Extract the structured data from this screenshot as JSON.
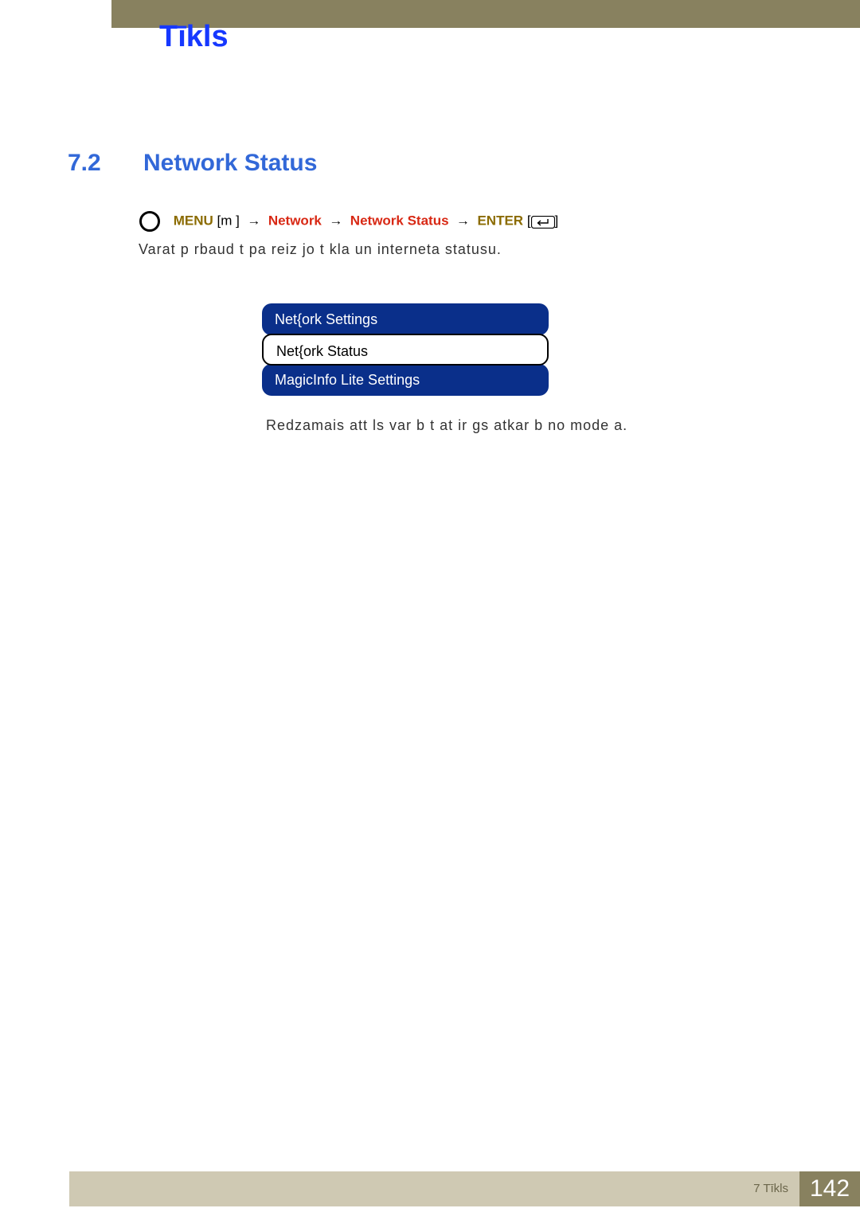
{
  "chapter": {
    "title": "Tīkls"
  },
  "section": {
    "num": "7.2",
    "title": "Network Status"
  },
  "nav": {
    "menu": "MENU",
    "bracket_m": "m",
    "network": "Network",
    "network_status": "Network Status",
    "enter": "ENTER"
  },
  "desc": "Varat p rbaud t pa reiz jo t kla un interneta statusu.",
  "menu_items": {
    "a": "Net{ork Settings",
    "b": "Net{ork Status",
    "c": "MagicInfo Lite Settings"
  },
  "note": "Redzamais att ls var b t at  ir gs atkar b  no mode a.",
  "footer": {
    "text": "7 Tīkls",
    "page": "142"
  }
}
